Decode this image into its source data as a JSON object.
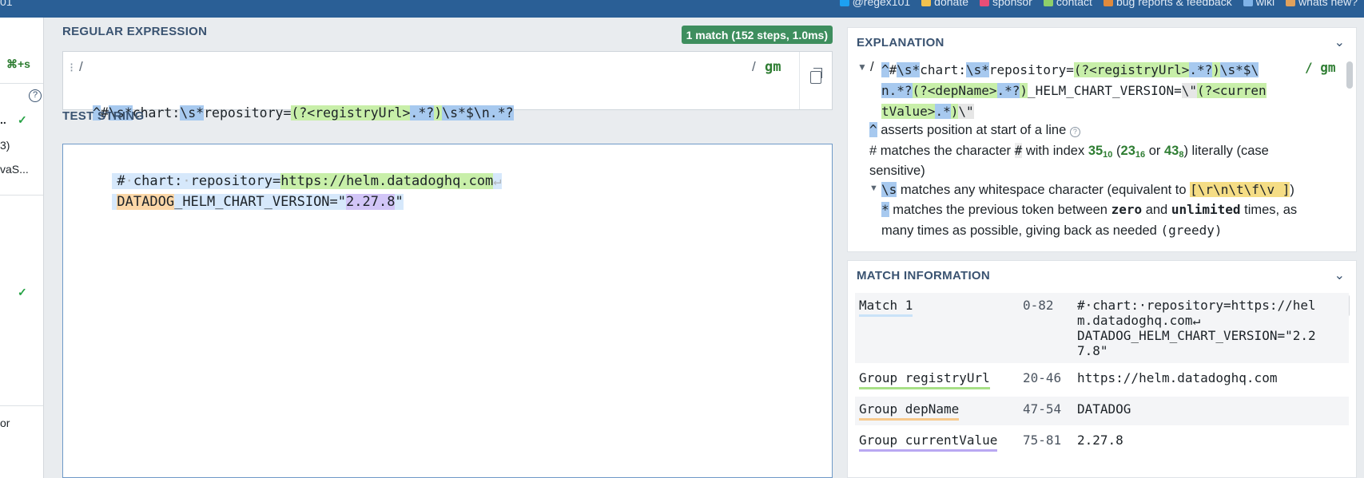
{
  "topbar": {
    "brand": "01",
    "links": [
      {
        "label": "@regex101",
        "icon": "twitter-icon",
        "color": "#1da1f2"
      },
      {
        "label": "donate",
        "icon": "dollar-icon",
        "color": "#f2c14e"
      },
      {
        "label": "sponsor",
        "icon": "heart-icon",
        "color": "#e94e77"
      },
      {
        "label": "contact",
        "icon": "mail-icon",
        "color": "#8ecf6a"
      },
      {
        "label": "bug reports & feedback",
        "icon": "bug-icon",
        "color": "#e08a3c"
      },
      {
        "label": "wiki",
        "icon": "book-icon",
        "color": "#7fb3e8"
      },
      {
        "label": "whats new?",
        "icon": "gift-icon",
        "color": "#e0a15c"
      }
    ]
  },
  "sidebar": {
    "shortcut": "⌘+s",
    "help_icon": "?",
    "item1_text": "..",
    "item2_text": "3)",
    "item3_text": "vaS...",
    "bottom_text": "or"
  },
  "regex": {
    "section_title": "REGULAR EXPRESSION",
    "match_badge": "1 match (152 steps, 1.0ms)",
    "delimiter_open": "/",
    "delimiter_close": "/",
    "flags": "gm",
    "line1_tokens": [
      {
        "t": "^",
        "c": "tk-q"
      },
      {
        "t": "#",
        "c": ""
      },
      {
        "t": "\\s*",
        "c": "tk-esc"
      },
      {
        "t": "chart:",
        "c": ""
      },
      {
        "t": "\\s*",
        "c": "tk-esc"
      },
      {
        "t": "repository=",
        "c": ""
      },
      {
        "t": "(?<registryUrl>",
        "c": "tk-grp"
      },
      {
        "t": ".*?",
        "c": "tk-esc"
      },
      {
        "t": ")",
        "c": "tk-grp"
      },
      {
        "t": "\\s*$\\n.*?",
        "c": "tk-esc"
      }
    ],
    "line2_tokens": [
      {
        "t": "(?<depName>",
        "c": "tk-grp"
      },
      {
        "t": ".*?",
        "c": "tk-esc"
      },
      {
        "t": ")",
        "c": "tk-grp"
      },
      {
        "t": "_HELM_CHART_VERSION=",
        "c": ""
      },
      {
        "t": "\\\"",
        "c": "tk-lit-bs"
      },
      {
        "t": "(?<currentValue>",
        "c": "tk-grp"
      },
      {
        "t": ".*",
        "c": "tk-esc"
      },
      {
        "t": ")",
        "c": "tk-grp"
      },
      {
        "t": "\\\"",
        "c": "tk-lit-bs"
      }
    ]
  },
  "test": {
    "section_title": "TEST STRING",
    "line1": {
      "prefix": "#",
      "chart": "chart:",
      "repo": "repository=",
      "url": "https://helm.datadoghq.com",
      "eol": "↵"
    },
    "line2": {
      "dep": "DATADOG",
      "mid": "_HELM_CHART_VERSION=\"",
      "val": "2.27.8",
      "end": "\""
    }
  },
  "explanation": {
    "title": "EXPLANATION",
    "regex_line1": "^#\\s*chart:\\s*repository=(?<registryUrl>.*?)\\s*$\\",
    "regex_line2": "n.*?(?<depName>.*?)_HELM_CHART_VERSION=\\\"(?<curren",
    "regex_line3": "tValue>.*)\\\"",
    "flags": "/ gm",
    "open": "/",
    "caret_token": "^",
    "caret_desc": "asserts position at start of a line",
    "hash_pre": "# matches the character",
    "hash_char": "#",
    "hash_mid": "with index",
    "n10": "35",
    "b10": "10",
    "n16": "23",
    "b16": "16",
    "n8": "43",
    "b8": "8",
    "hash_post": ") literally (case",
    "hash_post2": "sensitive)",
    "or_word": "or",
    "s_token": "\\s",
    "s_desc": "matches any whitespace character (equivalent to",
    "s_class": "[\\r\\n\\t\\f\\v ]",
    "star_token": "*",
    "star_desc1": "matches the previous token between",
    "zero": "zero",
    "and_word": "and",
    "unlimited": "unlimited",
    "star_desc2": "times, as",
    "star_desc3": "many times as possible, giving back as needed",
    "greedy": "(greedy)"
  },
  "match_info": {
    "title": "MATCH INFORMATION",
    "rows": [
      {
        "name": "Match 1",
        "range": "0-82",
        "value_lines": [
          "#·chart:·repository=https://hel",
          "m.datadoghq.com↵",
          "DATADOG_HELM_CHART_VERSION=\"2.2",
          "7.8\""
        ]
      },
      {
        "name": "Group registryUrl",
        "range": "20-46",
        "value_lines": [
          "https://helm.datadoghq.com"
        ]
      },
      {
        "name": "Group depName",
        "range": "47-54",
        "value_lines": [
          "DATADOG"
        ]
      },
      {
        "name": "Group currentValue",
        "range": "75-81",
        "value_lines": [
          "2.27.8"
        ]
      }
    ]
  }
}
